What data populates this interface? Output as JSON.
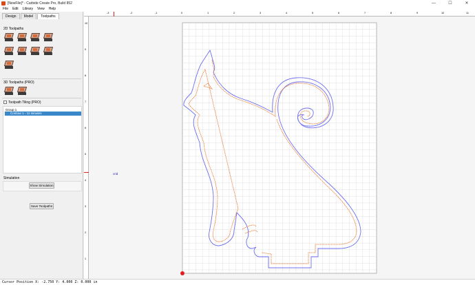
{
  "window": {
    "title": "[NewFile]* - Carbide Create Pro, Build 852",
    "minimize": "—",
    "maximize": "☐",
    "close": "✕"
  },
  "menu": [
    "File",
    "Edit",
    "Library",
    "View",
    "Help"
  ],
  "tabs": [
    "Design",
    "Model",
    "Toolpaths"
  ],
  "panel": {
    "toolpaths_2d": "2D Toolpaths",
    "toolpaths_3d": "3D Toolpaths (PRO)",
    "tiling_label": "Toolpath Tiling (PRO)",
    "current_tile_placeholder": "Current Tile",
    "setup_button": "Setup",
    "group_label": "Group 1",
    "toolpath_item": "Contour 1 - 11 minutes",
    "simulation_label": "Simulation",
    "show_simulation": "Show Simulation",
    "save_toolpaths": "Save Toolpaths"
  },
  "ruler": {
    "h_labels": [
      "-3",
      "-2",
      "-1",
      "0",
      "1",
      "2",
      "3",
      "4",
      "5",
      "6",
      "7",
      "8",
      "9",
      "10",
      "11"
    ],
    "v_labels": [
      "10",
      "9",
      "8",
      "7",
      "6",
      "5",
      "4",
      "3",
      "2",
      "1",
      "0",
      "-1",
      "-2",
      "-3",
      "-4",
      "-5"
    ]
  },
  "canvas": {
    "crid_label": "crid"
  },
  "status": {
    "cursor": "Cursor Position X: -2.750 Y: 4.000 Z: 0.000 in"
  },
  "colors": {
    "accent": "#3a88c9",
    "contour_outer": "#6e6ef0",
    "toolpath": "#e8742a",
    "origin": "#e02020"
  }
}
